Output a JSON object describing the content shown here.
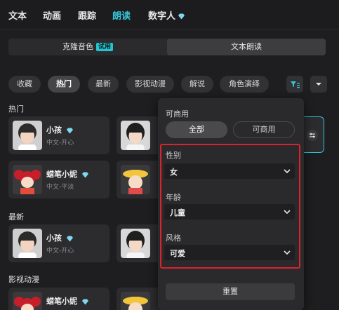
{
  "top_tabs": [
    {
      "label": "文本"
    },
    {
      "label": "动画"
    },
    {
      "label": "跟踪"
    },
    {
      "label": "朗读"
    },
    {
      "label": "数字人"
    }
  ],
  "segment": {
    "clone_label": "克隆音色",
    "trial_badge": "试用",
    "tts_label": "文本朗读"
  },
  "filters": [
    "收藏",
    "热门",
    "最新",
    "影视动漫",
    "解说",
    "角色演绎"
  ],
  "sections": {
    "hot": "热门",
    "latest": "最新",
    "film": "影视动漫"
  },
  "cards": {
    "hot": [
      {
        "name": "小孩",
        "sub": "中文-开心",
        "vip": true
      },
      {
        "name": "蜡笔小妮",
        "sub": "中文-平淡",
        "vip": true
      }
    ],
    "latest": [
      {
        "name": "小孩",
        "sub": "中文-开心",
        "vip": true
      }
    ],
    "film": [
      {
        "name": "蜡笔小妮",
        "vip": true
      }
    ]
  },
  "popover": {
    "commercial_label": "可商用",
    "seg_all": "全部",
    "seg_commercial": "可商用",
    "gender_label": "性别",
    "gender_value": "女",
    "age_label": "年龄",
    "age_value": "儿童",
    "style_label": "风格",
    "style_value": "可爱",
    "reset_label": "重置"
  },
  "colors": {
    "accent": "#35c6d8",
    "highlight_box": "#d9232e",
    "diamond": "#7fd8f2"
  }
}
